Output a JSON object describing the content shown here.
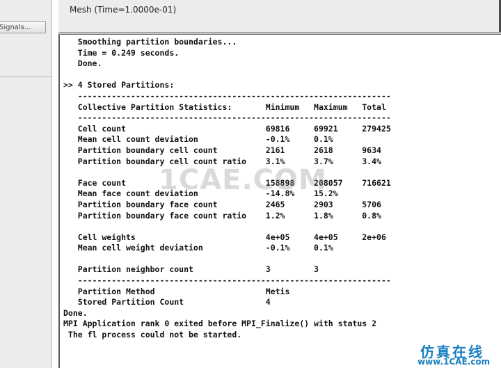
{
  "left_panel": {
    "signals_button_label": "Signals..."
  },
  "graphics_window": {
    "title": "Mesh (Time=1.0000e-01)"
  },
  "console": {
    "lines": [
      "   Smoothing partition boundaries...",
      "   Time = 0.249 seconds.",
      "   Done.",
      "",
      ">> 4 Stored Partitions:",
      "   -----------------------------------------------------------------",
      "   Collective Partition Statistics:       Minimum   Maximum   Total",
      "   -----------------------------------------------------------------",
      "   Cell count                             69816     69921     279425",
      "   Mean cell count deviation              -0.1%     0.1%",
      "   Partition boundary cell count          2161      2618      9634",
      "   Partition boundary cell count ratio    3.1%      3.7%      3.4%",
      "",
      "   Face count                             158898    208057    716621",
      "   Mean face count deviation              -14.8%    15.2%",
      "   Partition boundary face count          2465      2903      5706",
      "   Partition boundary face count ratio    1.2%      1.8%      0.8%",
      "",
      "   Cell weights                           4e+05     4e+05     2e+06",
      "   Mean cell weight deviation             -0.1%     0.1%",
      "",
      "   Partition neighbor count               3         3",
      "   -----------------------------------------------------------------",
      "   Partition Method                       Metis",
      "   Stored Partition Count                 4",
      "Done.",
      "MPI Application rank 0 exited before MPI_Finalize() with status 2",
      " The fl process could not be started."
    ]
  },
  "watermark": {
    "text": "1CAE.COM",
    "brand_cn": "仿真在线",
    "brand_url": "www.1CAE.com"
  },
  "colors": {
    "brand_blue": "#1a7fc1",
    "console_text": "#111111",
    "panel_bg": "#ececec"
  }
}
